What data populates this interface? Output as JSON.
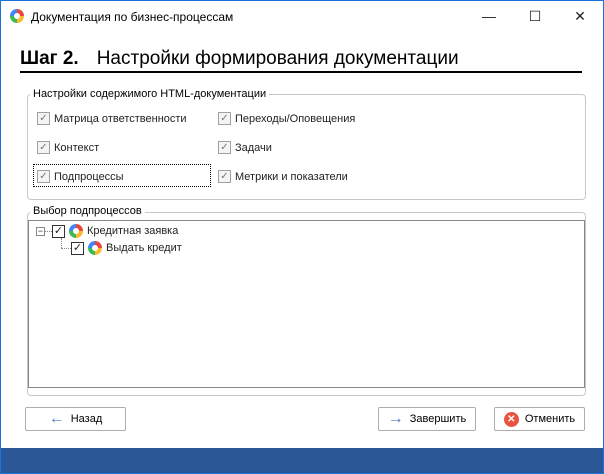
{
  "window": {
    "title": "Документация по бизнес-процессам",
    "minimize": "—",
    "maximize": "☐",
    "close": "✕"
  },
  "heading": {
    "step": "Шаг 2.",
    "title": "Настройки формирования документации"
  },
  "content_group": {
    "legend": "Настройки содержимого HTML-документации",
    "options": [
      {
        "label": "Матрица ответственности",
        "checked": true
      },
      {
        "label": "Переходы/Оповещения",
        "checked": true
      },
      {
        "label": "Контекст",
        "checked": true
      },
      {
        "label": "Задачи",
        "checked": true
      },
      {
        "label": "Подпроцессы",
        "checked": true
      },
      {
        "label": "Метрики и показатели",
        "checked": true
      }
    ]
  },
  "subprocess_group": {
    "legend": "Выбор подпроцессов",
    "tree": [
      {
        "label": "Кредитная заявка",
        "checked": true,
        "expanded": true,
        "expander": "−"
      },
      {
        "label": "Выдать кредит",
        "checked": true
      }
    ]
  },
  "buttons": {
    "back": "Назад",
    "finish": "Завершить",
    "cancel": "Отменить"
  },
  "check_mark": "✓",
  "colors": {
    "accent": "#2b5797",
    "arrow": "#4a7bc0",
    "cancel": "#e8543f"
  }
}
